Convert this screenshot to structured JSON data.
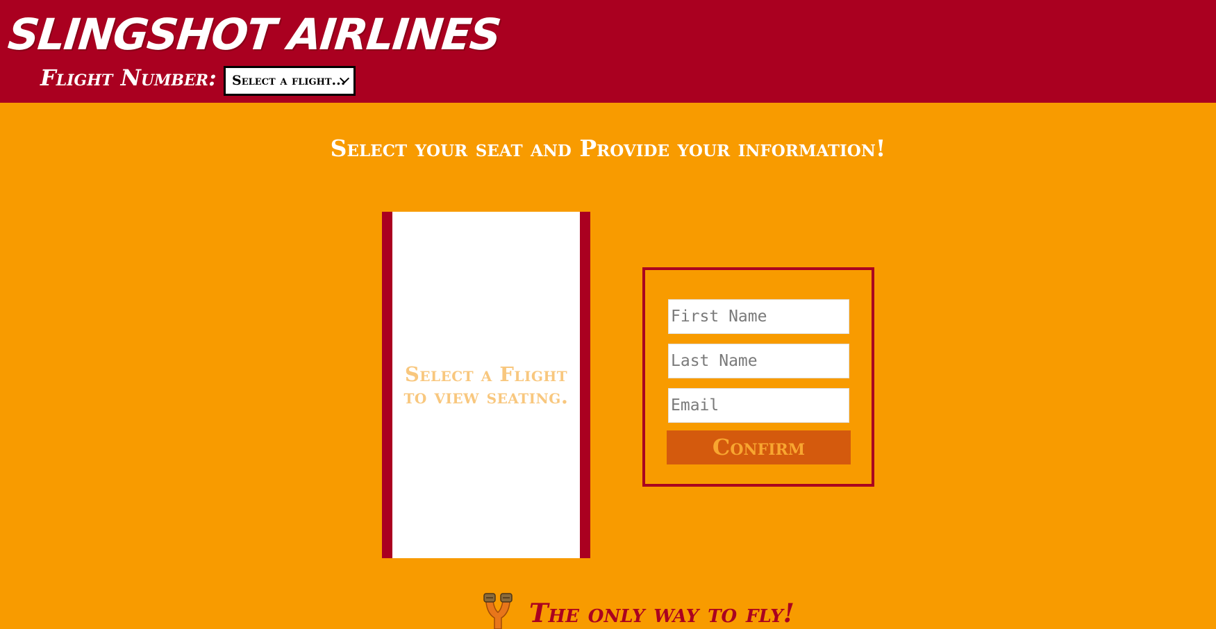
{
  "header": {
    "brand": "SLINGSHOT AIRLINES",
    "flight_number_label": "Flight Number:",
    "flight_select": {
      "selected": "Select a flight...",
      "icon": "chevron-down-icon"
    }
  },
  "main": {
    "heading": "Select your seat and Provide your information!",
    "seat_map": {
      "placeholder": "Select a Flight to view seating."
    },
    "form": {
      "first_name_placeholder": "First Name",
      "last_name_placeholder": "Last Name",
      "email_placeholder": "Email",
      "confirm_label": "Confirm"
    }
  },
  "footer": {
    "icon": "slingshot-icon",
    "tagline": "The only way to fly!"
  },
  "colors": {
    "header_bg": "#aa0020",
    "page_bg": "#f89b00",
    "confirm_bg": "#d45a0d",
    "confirm_text": "#f8a630",
    "placeholder_text": "#f8c77e"
  }
}
